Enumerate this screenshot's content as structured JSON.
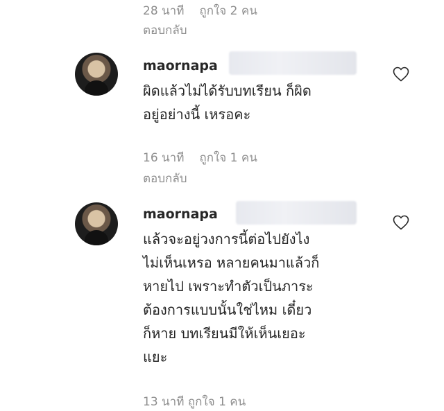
{
  "top": {
    "time": "28 นาที",
    "likes": "ถูกใจ 2 คน",
    "reply": "ตอบกลับ"
  },
  "comments": [
    {
      "username": "maornapa",
      "lines": [
        "ผิดแล้วไม่ได้รับบทเรียน ก็ผิด",
        "อยู่อย่างนี้ เหรอคะ"
      ],
      "time": "16 นาที",
      "likes": "ถูกใจ 1 คน",
      "reply": "ตอบกลับ"
    },
    {
      "username": "maornapa",
      "lines": [
        "แล้วจะอยู่วงการนี้ต่อไปยังไง",
        "ไม่เห็นเหรอ หลายคนมาแล้วก็",
        "หายไป เพราะทำตัวเป็นภาระ",
        "ต้องการแบบนั้นใช่ไหม เดี๋ยว",
        "ก็หาย บทเรียนมีให้เห็นเยอะ",
        "แยะ"
      ]
    }
  ],
  "bottom_partial": "13 นาที   ถูกใจ 1 คน",
  "icons": {
    "avatar": "profile-photo",
    "like": "heart-outline-icon"
  }
}
